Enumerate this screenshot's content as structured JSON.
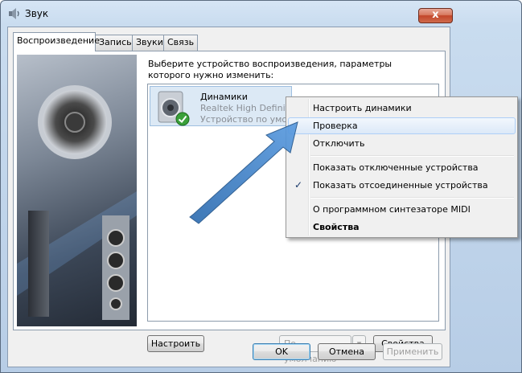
{
  "window": {
    "title": "Звук",
    "close_label": "x"
  },
  "tabs": [
    {
      "label": "Воспроизведение",
      "active": true
    },
    {
      "label": "Запись",
      "active": false
    },
    {
      "label": "Звуки",
      "active": false
    },
    {
      "label": "Связь",
      "active": false
    }
  ],
  "panel": {
    "prompt": "Выберите устройство воспроизведения, параметры которого нужно изменить:",
    "device": {
      "name": "Динамики",
      "driver": "Realtek High Definiti",
      "status": "Устройство по умолч",
      "icon": "speaker-icon",
      "status_icon": "green-check-icon"
    },
    "configure_label": "Настроить",
    "default_label": "По умолчанию",
    "properties_label": "Свойства"
  },
  "context_menu": {
    "items": [
      {
        "label": "Настроить динамики"
      },
      {
        "label": "Проверка",
        "highlighted": true
      },
      {
        "label": "Отключить"
      },
      {
        "label": "Показать отключенные устройства"
      },
      {
        "label": "Показать отсоединенные устройства",
        "checked": true
      },
      {
        "label": "О программном синтезаторе MIDI"
      },
      {
        "label": "Свойства",
        "bold": true
      }
    ]
  },
  "footer": {
    "ok_label": "OK",
    "cancel_label": "Отмена",
    "apply_label": "Применить"
  },
  "colors": {
    "accent_arrow": "#3d7fc4",
    "menu_highlight": "#dce9f8",
    "selection": "#dce9f5"
  }
}
